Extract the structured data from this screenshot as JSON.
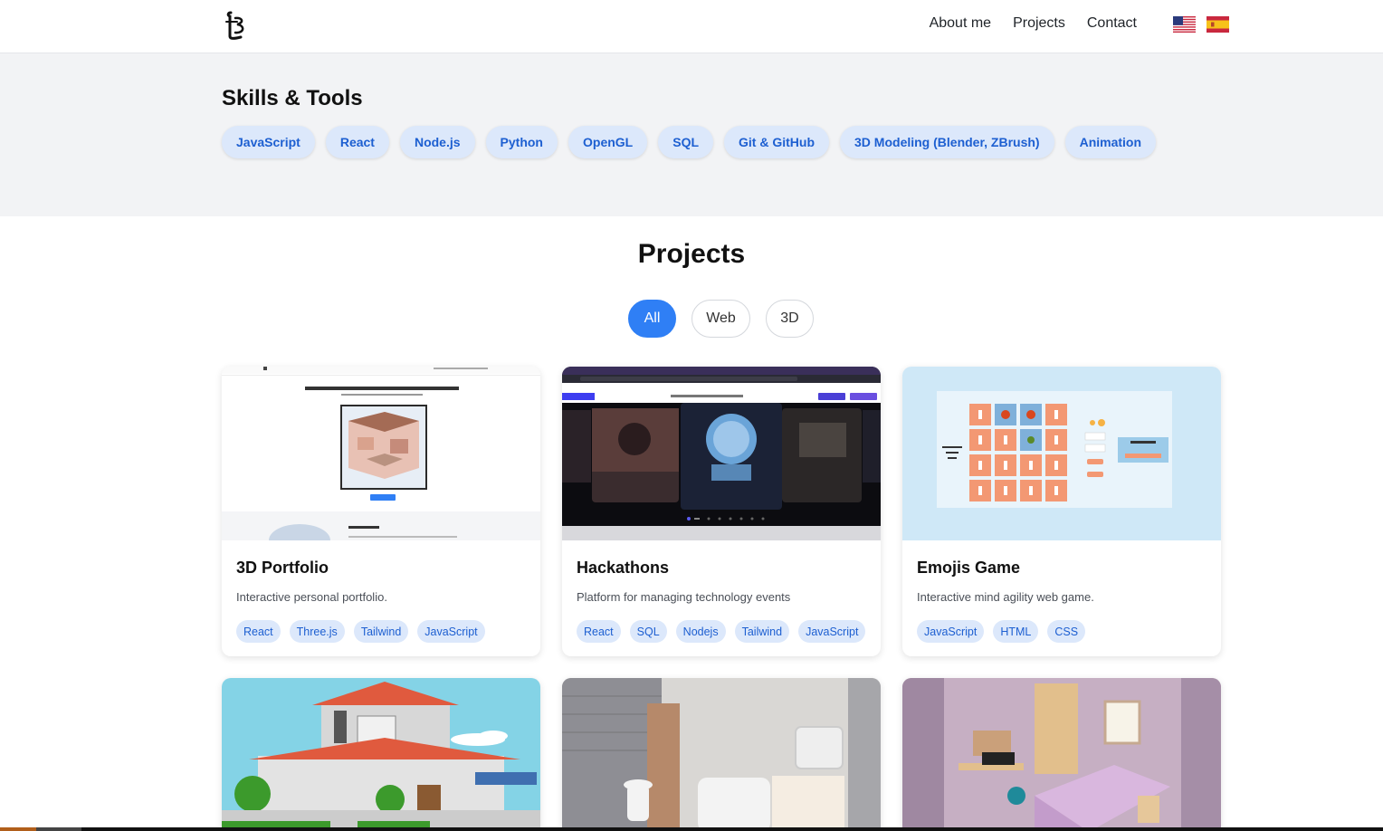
{
  "nav": {
    "links": [
      "About me",
      "Projects",
      "Contact"
    ],
    "languages": [
      "en-flag-icon",
      "es-flag-icon"
    ]
  },
  "skills": {
    "title": "Skills & Tools",
    "items": [
      "JavaScript",
      "React",
      "Node.js",
      "Python",
      "OpenGL",
      "SQL",
      "Git & GitHub",
      "3D Modeling (Blender, ZBrush)",
      "Animation"
    ]
  },
  "projects": {
    "title": "Projects",
    "filters": [
      "All",
      "Web",
      "3D"
    ],
    "active_filter": "All",
    "cards": [
      {
        "title": "3D Portfolio",
        "description": "Interactive personal portfolio.",
        "tags": [
          "React",
          "Three.js",
          "Tailwind",
          "JavaScript"
        ]
      },
      {
        "title": "Hackathons",
        "description": "Platform for managing technology events",
        "tags": [
          "React",
          "SQL",
          "Nodejs",
          "Tailwind",
          "JavaScript"
        ]
      },
      {
        "title": "Emojis Game",
        "description": "Interactive mind agility web game.",
        "tags": [
          "JavaScript",
          "HTML",
          "CSS"
        ]
      }
    ]
  },
  "colors": {
    "accent": "#2f7ff5",
    "chip_bg": "#dce8fb",
    "chip_text": "#1d5fd1",
    "skills_bg": "#f2f3f5"
  }
}
